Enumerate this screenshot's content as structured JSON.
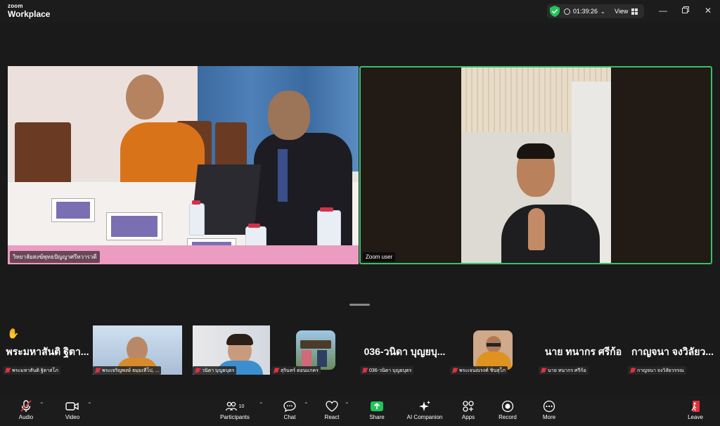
{
  "titlebar": {
    "brand_top": "zoom",
    "brand_bottom": "Workplace",
    "timer": "01:39:26",
    "view_label": "View"
  },
  "videos": {
    "left_name": "วิทยาลัยสงฆ์พุทธปัญญาศรีทวารวดี",
    "right_name": "Zoom user"
  },
  "tiles": [
    {
      "big": "พระมหาสันติ ฐิตา...",
      "label": "พระมหาสันติ ฐิตาสโภ"
    },
    {
      "label": "พระเจริญพงษ์ ธมฺมเทีโป, ..."
    },
    {
      "label": "วนิดา บุญยบุตร"
    },
    {
      "label": "สุรินทร์ ดอนแกคร"
    },
    {
      "big": "036-วนิดา บุญยบุ...",
      "label": "036-วนิดา บุญยบุตร"
    },
    {
      "label": "พระเจนณรงค์ ชินสุโภ"
    },
    {
      "big": "นาย ทนากร ศรีก้อ",
      "label": "นาย ทนากร ศรีก้อ"
    },
    {
      "big": "กาญจนา จงวิลัยว...",
      "label": "กาญจนา จงวิลัยวรรณ"
    }
  ],
  "toolbar": {
    "audio": "Audio",
    "video": "Video",
    "participants": "Participants",
    "participants_count": "10",
    "chat": "Chat",
    "react": "React",
    "share": "Share",
    "ai_companion": "AI Companion",
    "apps": "Apps",
    "record": "Record",
    "more": "More",
    "leave": "Leave"
  },
  "colors": {
    "active_speaker": "#37c06c",
    "share_green": "#21c45a",
    "muted_red": "#e0303e",
    "leave_red": "#e0303e"
  }
}
